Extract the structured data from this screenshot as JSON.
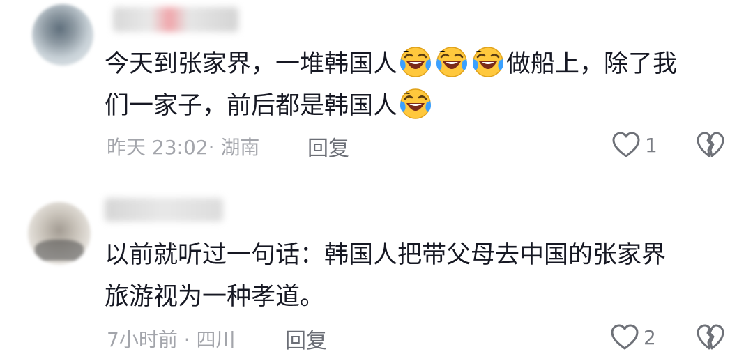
{
  "comments": [
    {
      "lines": [
        "今天到张家界，一堆韩国人",
        "做船上，除了我",
        "们一家子，前后都是韩国人"
      ],
      "meta": "昨天 23:02· 湖南",
      "reply_label": "回复",
      "like_count": "1",
      "icons": {
        "avatar": "avatar-blurred",
        "emoji": "laughing-crying-emoji",
        "like": "heart-outline-icon",
        "dislike": "broken-heart-icon"
      }
    },
    {
      "lines": [
        "以前就听过一句话：韩国人把带父母去中国的张家界",
        "旅游视为一种孝道。"
      ],
      "meta": "7小时前 · 四川",
      "reply_label": "回复",
      "like_count": "2",
      "icons": {
        "avatar": "avatar-blurred",
        "like": "heart-outline-icon",
        "dislike": "broken-heart-icon"
      }
    }
  ],
  "colors": {
    "text": "#161823",
    "meta": "#a3a5ab",
    "reply": "#6b6e76",
    "emoji_face": "#ffc83d",
    "emoji_tear": "#3aa0ff"
  }
}
